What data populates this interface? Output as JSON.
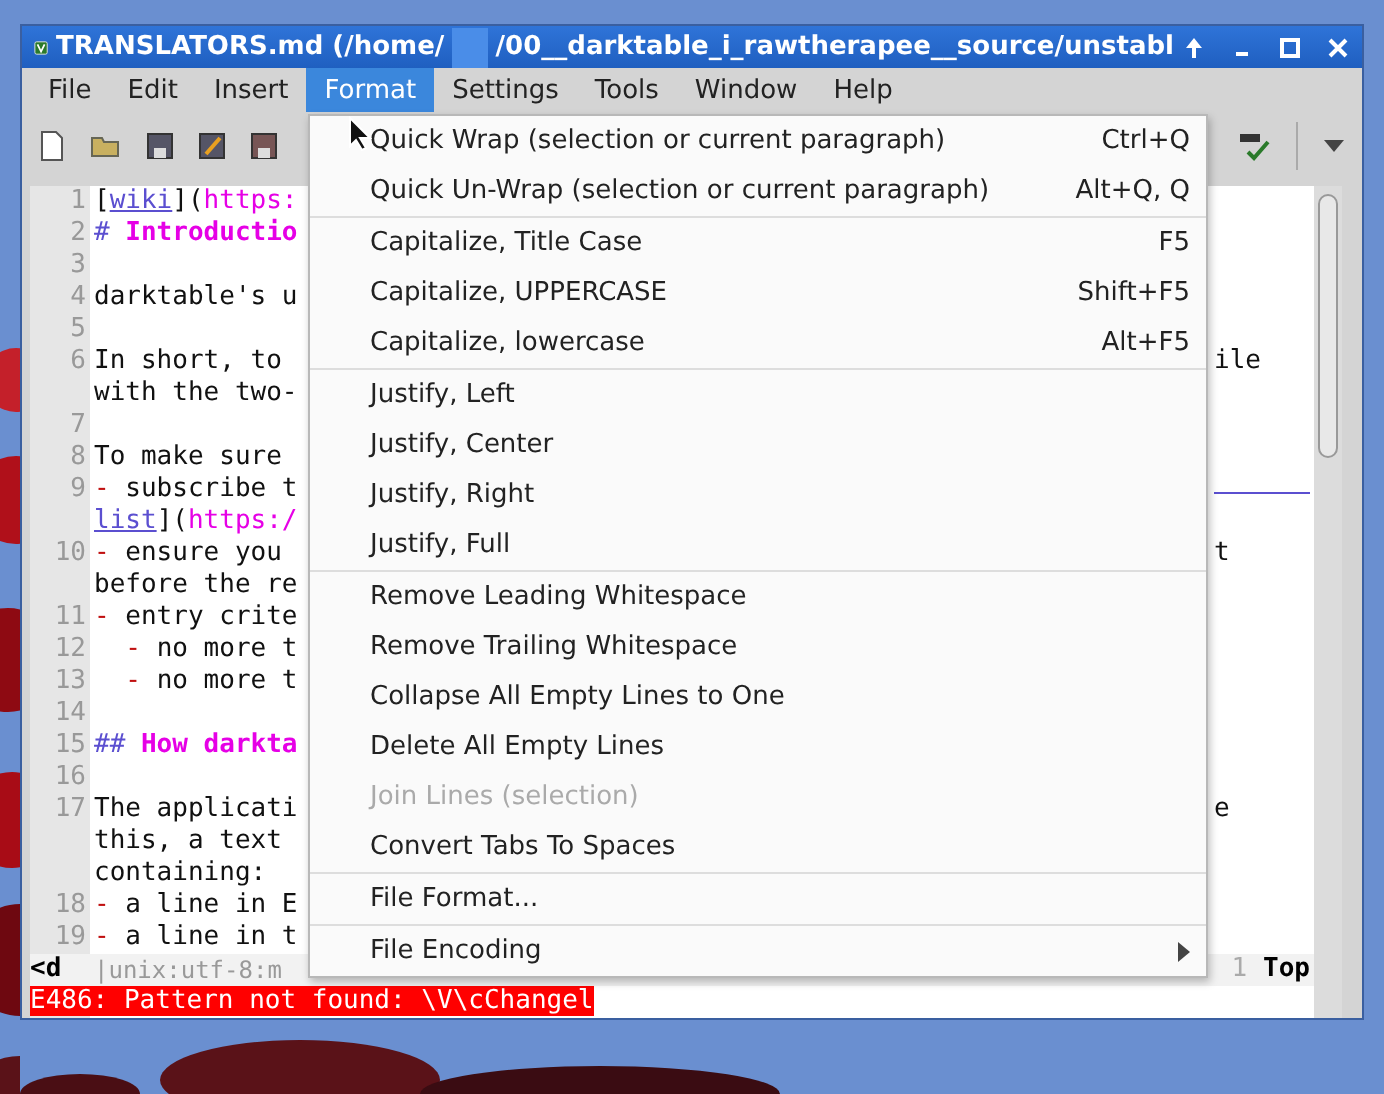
{
  "window": {
    "title_parts": [
      "TRANSLATORS.md (/home/",
      "/00__darktable_i_rawtherapee__source/unstabl"
    ]
  },
  "menubar": [
    {
      "label": "File",
      "selected": false
    },
    {
      "label": "Edit",
      "selected": false
    },
    {
      "label": "Insert",
      "selected": false
    },
    {
      "label": "Format",
      "selected": true
    },
    {
      "label": "Settings",
      "selected": false
    },
    {
      "label": "Tools",
      "selected": false
    },
    {
      "label": "Window",
      "selected": false
    },
    {
      "label": "Help",
      "selected": false
    }
  ],
  "editor": {
    "rows": [
      {
        "num": "1",
        "segments": [
          {
            "t": "[",
            "kind": "plain"
          },
          {
            "t": "wiki",
            "kind": "link"
          },
          {
            "t": "](",
            "kind": "plain"
          },
          {
            "t": "https:",
            "kind": "url"
          }
        ]
      },
      {
        "num": "2",
        "segments": [
          {
            "t": "# ",
            "kind": "mark"
          },
          {
            "t": "Introductio",
            "kind": "head"
          }
        ]
      },
      {
        "num": "3",
        "segments": []
      },
      {
        "num": "4",
        "segments": [
          {
            "t": "darktable's u",
            "kind": "plain"
          }
        ]
      },
      {
        "num": "5",
        "segments": []
      },
      {
        "num": "6",
        "segments": [
          {
            "t": "In short, to",
            "kind": "plain"
          }
        ],
        "tail": "ile"
      },
      {
        "segments": [
          {
            "t": "with the two-",
            "kind": "plain"
          }
        ]
      },
      {
        "num": "7",
        "segments": []
      },
      {
        "num": "8",
        "segments": [
          {
            "t": "To make sure",
            "kind": "plain"
          }
        ]
      },
      {
        "num": "9",
        "segments": [
          {
            "t": "- ",
            "kind": "bullet"
          },
          {
            "t": "subscribe t",
            "kind": "plain"
          }
        ],
        "tail_link": true
      },
      {
        "segments": [
          {
            "t": "list",
            "kind": "link"
          },
          {
            "t": "](",
            "kind": "plain"
          },
          {
            "t": "https:/",
            "kind": "url"
          }
        ]
      },
      {
        "num": "10",
        "segments": [
          {
            "t": "- ",
            "kind": "bullet"
          },
          {
            "t": "ensure you",
            "kind": "plain"
          }
        ],
        "tail": "t"
      },
      {
        "segments": [
          {
            "t": "before the re",
            "kind": "plain"
          }
        ]
      },
      {
        "num": "11",
        "segments": [
          {
            "t": "- ",
            "kind": "bullet"
          },
          {
            "t": "entry crite",
            "kind": "plain"
          }
        ]
      },
      {
        "num": "12",
        "segments": [
          {
            "t": "  - ",
            "kind": "bullet"
          },
          {
            "t": "no more t",
            "kind": "plain"
          }
        ]
      },
      {
        "num": "13",
        "segments": [
          {
            "t": "  - ",
            "kind": "bullet"
          },
          {
            "t": "no more t",
            "kind": "plain"
          }
        ]
      },
      {
        "num": "14",
        "segments": []
      },
      {
        "num": "15",
        "segments": [
          {
            "t": "## ",
            "kind": "mark"
          },
          {
            "t": "How darkta",
            "kind": "head"
          }
        ]
      },
      {
        "num": "16",
        "segments": []
      },
      {
        "num": "17",
        "segments": [
          {
            "t": "The applicati",
            "kind": "plain"
          }
        ],
        "tail": "e"
      },
      {
        "segments": [
          {
            "t": "this, a text",
            "kind": "plain"
          }
        ]
      },
      {
        "segments": [
          {
            "t": "containing:",
            "kind": "plain"
          }
        ]
      },
      {
        "num": "18",
        "segments": [
          {
            "t": "- ",
            "kind": "bullet"
          },
          {
            "t": "a line in E",
            "kind": "plain"
          }
        ]
      },
      {
        "num": "19",
        "segments": [
          {
            "t": "- ",
            "kind": "bullet"
          },
          {
            "t": "a line in t",
            "kind": "plain"
          }
        ]
      }
    ],
    "status": {
      "mode": "<d",
      "info": "|unix:utf-8:m",
      "line": "1",
      "position": "Top"
    },
    "message": "E486: Pattern not found: \\V\\cChangel"
  },
  "format_menu": [
    [
      {
        "label": "Quick Wrap (selection or current paragraph)",
        "shortcut": "Ctrl+Q",
        "disabled": false
      },
      {
        "label": "Quick Un-Wrap (selection or current paragraph)",
        "shortcut": "Alt+Q, Q",
        "disabled": false
      }
    ],
    [
      {
        "label": "Capitalize, Title Case",
        "shortcut": "F5",
        "disabled": false
      },
      {
        "label": "Capitalize, UPPERCASE",
        "shortcut": "Shift+F5",
        "disabled": false
      },
      {
        "label": "Capitalize, lowercase",
        "shortcut": "Alt+F5",
        "disabled": false
      }
    ],
    [
      {
        "label": "Justify, Left",
        "disabled": false
      },
      {
        "label": "Justify, Center",
        "disabled": false
      },
      {
        "label": "Justify, Right",
        "disabled": false
      },
      {
        "label": "Justify, Full",
        "disabled": false
      }
    ],
    [
      {
        "label": "Remove Leading Whitespace",
        "disabled": false
      },
      {
        "label": "Remove Trailing Whitespace",
        "disabled": false
      },
      {
        "label": "Collapse All Empty Lines to One",
        "disabled": false
      },
      {
        "label": "Delete All Empty Lines",
        "disabled": false
      },
      {
        "label": "Join Lines (selection)",
        "disabled": true
      },
      {
        "label": "Convert Tabs To Spaces",
        "disabled": false
      }
    ],
    [
      {
        "label": "File Format...",
        "disabled": false
      }
    ],
    [
      {
        "label": "File Encoding",
        "disabled": false,
        "submenu": true
      }
    ]
  ]
}
